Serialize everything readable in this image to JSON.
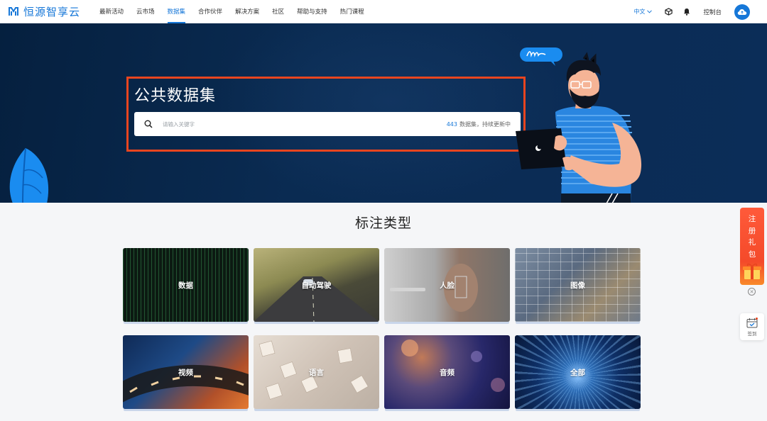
{
  "brand": {
    "name": "恒源智享云",
    "color": "#1677d8"
  },
  "nav": {
    "items": [
      {
        "label": "最新活动",
        "active": false
      },
      {
        "label": "云市场",
        "active": false
      },
      {
        "label": "数据集",
        "active": true
      },
      {
        "label": "合作伙伴",
        "active": false
      },
      {
        "label": "解决方案",
        "active": false
      },
      {
        "label": "社区",
        "active": false
      },
      {
        "label": "帮助与支持",
        "active": false
      },
      {
        "label": "热门课程",
        "active": false
      }
    ],
    "language": "中文",
    "console_label": "控制台",
    "icons": [
      "cube-icon",
      "bell-icon",
      "cloud-avatar-icon"
    ]
  },
  "hero": {
    "title": "公共数据集",
    "search": {
      "placeholder": "请输入关键字",
      "count": "443",
      "count_suffix": "数据集，持续更新中"
    },
    "highlight_color": "#e8451f"
  },
  "section": {
    "title": "标注类型",
    "cards": [
      {
        "label": "数据"
      },
      {
        "label": "自动驾驶"
      },
      {
        "label": "人脸"
      },
      {
        "label": "图像"
      },
      {
        "label": "视频"
      },
      {
        "label": "语言"
      },
      {
        "label": "音频"
      },
      {
        "label": "全部"
      }
    ]
  },
  "floating": {
    "gift_chars": [
      "注",
      "册",
      "礼",
      "包"
    ],
    "signin_label": "签到"
  }
}
